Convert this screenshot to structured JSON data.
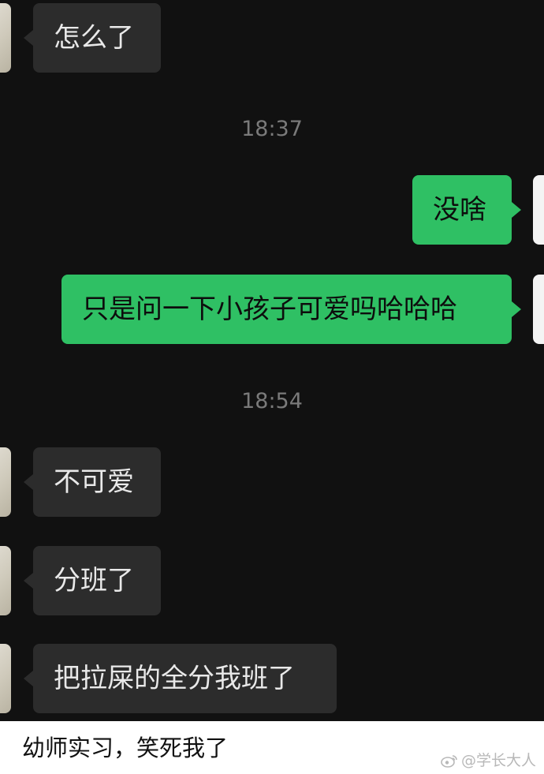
{
  "messages": [
    {
      "side": "in",
      "text": "怎么了"
    },
    {
      "timestamp": "18:37"
    },
    {
      "side": "out",
      "text": "没啥"
    },
    {
      "side": "out",
      "text": "只是问一下小孩子可爱吗哈哈哈"
    },
    {
      "timestamp": "18:54"
    },
    {
      "side": "in",
      "text": "不可爱"
    },
    {
      "side": "in",
      "text": "分班了"
    },
    {
      "side": "in",
      "text": "把拉屎的全分我班了"
    }
  ],
  "caption": "幼师实习，笑死我了",
  "watermark": "@学长大人",
  "colors": {
    "background": "#111111",
    "incoming_bubble": "#2c2c2c",
    "outgoing_bubble": "#2fc064",
    "timestamp": "#7a7a7a"
  }
}
